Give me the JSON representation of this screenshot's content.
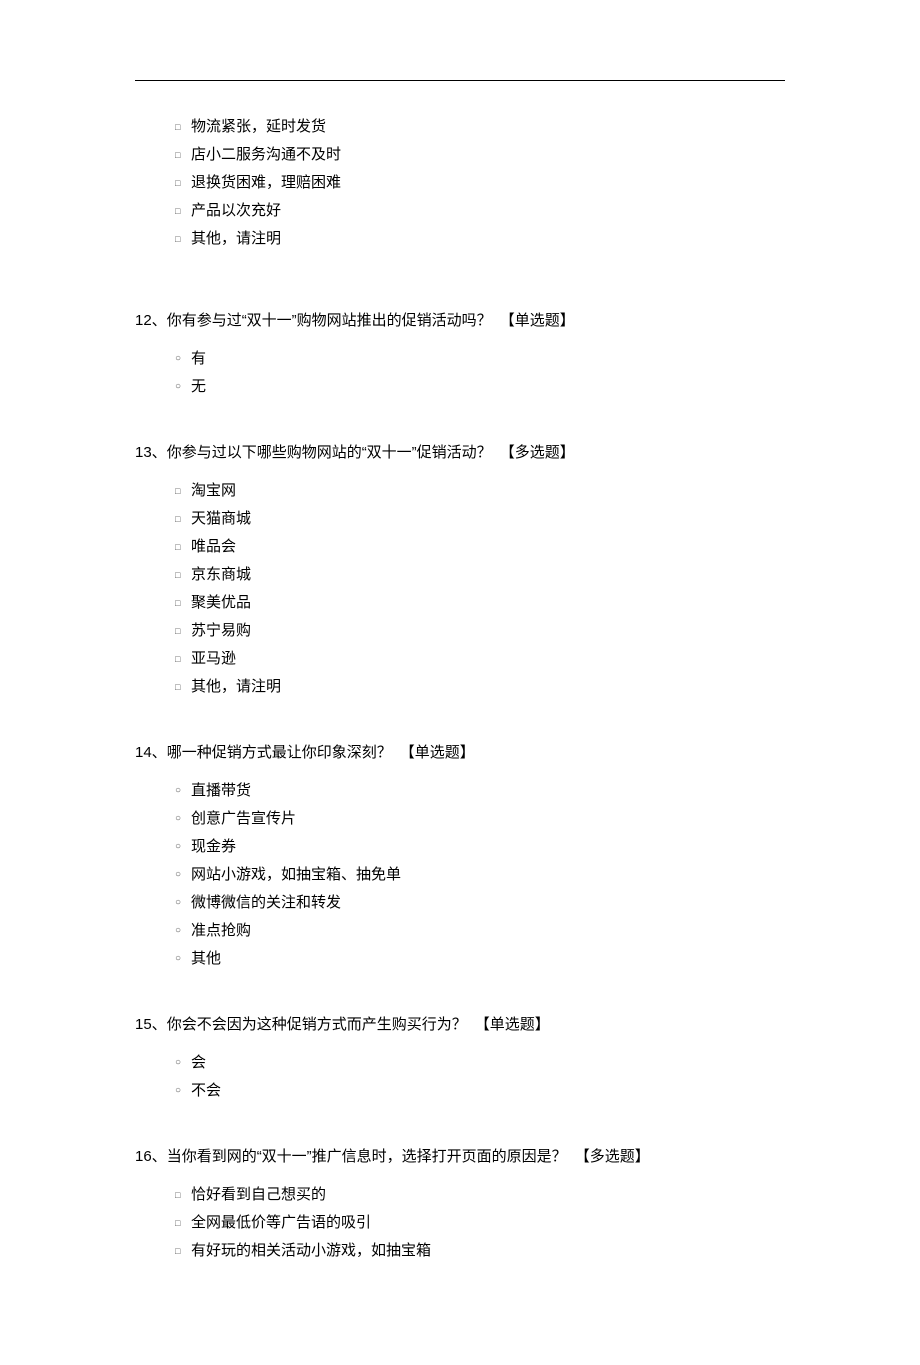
{
  "residual": {
    "options": [
      "物流紧张，延时发货",
      "店小二服务沟通不及时",
      "退换货困难，理赔困难",
      "产品以次充好",
      "其他，请注明"
    ]
  },
  "questions": [
    {
      "num": "12、",
      "text": "你有参与过“双十一”购物网站推出的促销活动吗？",
      "tag": "【单选题】",
      "type": "single",
      "options": [
        "有",
        "无"
      ]
    },
    {
      "num": "13、",
      "text": "你参与过以下哪些购物网站的“双十一”促销活动？",
      "tag": "【多选题】",
      "type": "multi",
      "options": [
        "淘宝网",
        "天猫商城",
        "唯品会",
        "京东商城",
        "聚美优品",
        "苏宁易购",
        "亚马逊",
        "其他，请注明"
      ]
    },
    {
      "num": "14、",
      "text": "哪一种促销方式最让你印象深刻？",
      "tag": "【单选题】",
      "type": "single",
      "options": [
        "直播带货",
        "创意广告宣传片",
        "现金券",
        "网站小游戏，如抽宝箱、抽免单",
        "微博微信的关注和转发",
        "准点抢购",
        "其他"
      ]
    },
    {
      "num": "15、",
      "text": "你会不会因为这种促销方式而产生购买行为？",
      "tag": "【单选题】",
      "type": "single",
      "options": [
        "会",
        "不会"
      ]
    },
    {
      "num": "16、",
      "text": "当你看到网的“双十一”推广信息时，选择打开页面的原因是？",
      "tag": "【多选题】",
      "type": "multi",
      "options": [
        "恰好看到自己想买的",
        "全网最低价等广告语的吸引",
        "有好玩的相关活动小游戏，如抽宝箱"
      ]
    }
  ],
  "markers": {
    "single": "○",
    "multi": "□"
  }
}
